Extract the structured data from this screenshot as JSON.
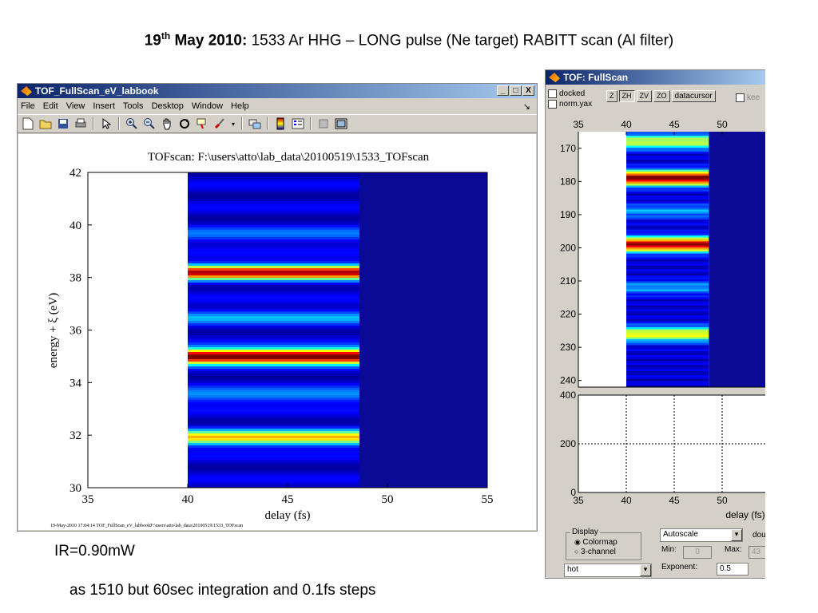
{
  "slide": {
    "title_bold": "19",
    "title_sup": "th",
    "title_bold2": " May 2010:",
    "title_rest": " 1533  Ar HHG – LONG pulse (Ne target) RABITT scan (Al filter)",
    "ir_note": "IR=0.90mW",
    "integration_note": "as 1510 but 60sec integration and 0.1fs steps"
  },
  "left_window": {
    "title": "TOF_FullScan_eV_labbook",
    "window_buttons": [
      "_",
      "□",
      "X"
    ],
    "menu": [
      "File",
      "Edit",
      "View",
      "Insert",
      "Tools",
      "Desktop",
      "Window",
      "Help"
    ],
    "menu_arrow": "↘",
    "toolbar_icons": [
      "new-file-icon",
      "open-folder-icon",
      "save-icon",
      "print-icon",
      "pointer-icon",
      "zoom-in-icon",
      "zoom-out-icon",
      "pan-hand-icon",
      "rotate-icon",
      "data-cursor-icon",
      "brush-icon",
      "dropdown-arrow-icon",
      "link-icon",
      "colorbar-icon",
      "legend-icon",
      "hide-plot-tools-icon",
      "show-plot-tools-icon"
    ],
    "plot_title": "TOFscan: F:\\users\\atto\\lab_data\\20100519\\1533_TOFscan",
    "footer": "19-May-2010 17:04:14  TOF_FullScan_eV_labbookF:\\users\\atto\\lab_data\\20100519\\1533_TOFscan"
  },
  "right_window": {
    "title": "TOF: FullScan",
    "docked_label": "docked",
    "normyax_label": "norm.yax",
    "buttons": [
      "Z",
      "ZH",
      "ZV",
      "ZO",
      "datacursor"
    ],
    "keep_label": "kee",
    "display_group": "Display",
    "colormap_label": "Colormap",
    "three_channel_label": "3-channel",
    "colormap_select": "hot",
    "autoscale_select": "Autoscale",
    "dou_label": "dou",
    "min_label": "Min:",
    "min_value": "0",
    "max_label": "Max:",
    "max_value": "43",
    "exponent_label": "Exponent:",
    "exponent_value": "0.5"
  },
  "chart_data": [
    {
      "type": "heatmap",
      "title": "TOFscan: F:\\users\\atto\\lab_data\\20100519\\1533_TOFscan",
      "xlabel": "delay (fs)",
      "ylabel": "energy + ξ (eV)",
      "xlim": [
        35,
        55
      ],
      "ylim": [
        30,
        42
      ],
      "x_ticks": [
        "35",
        "40",
        "45",
        "50",
        "55"
      ],
      "y_ticks": [
        "30",
        "32",
        "34",
        "36",
        "38",
        "40",
        "42"
      ],
      "data_x_range": [
        40,
        48.6
      ],
      "bands": [
        {
          "center": 31.9,
          "intensity": 0.6
        },
        {
          "center": 35.0,
          "intensity": 1.0
        },
        {
          "center": 38.2,
          "intensity": 0.85
        },
        {
          "center": 33.5,
          "intensity": 0.2
        },
        {
          "center": 36.5,
          "intensity": 0.2
        },
        {
          "center": 39.6,
          "intensity": 0.15
        }
      ]
    },
    {
      "type": "heatmap",
      "xlim": [
        35,
        55
      ],
      "ylim": [
        165,
        242
      ],
      "x_ticks": [
        "35",
        "40",
        "45",
        "50"
      ],
      "y_ticks": [
        "170",
        "180",
        "190",
        "200",
        "210",
        "220",
        "230",
        "240"
      ],
      "data_x_range": [
        40,
        48.6
      ],
      "bands": [
        {
          "center": 179,
          "intensity": 0.95
        },
        {
          "center": 199,
          "intensity": 0.9
        },
        {
          "center": 226,
          "intensity": 0.55
        },
        {
          "center": 168,
          "intensity": 0.5
        },
        {
          "center": 189,
          "intensity": 0.2
        },
        {
          "center": 212,
          "intensity": 0.2
        }
      ]
    },
    {
      "type": "line",
      "xlabel": "delay (fs)",
      "xlim": [
        35,
        55
      ],
      "ylim": [
        0,
        400
      ],
      "x_ticks": [
        "35",
        "40",
        "45",
        "50"
      ],
      "y_ticks": [
        "0",
        "200",
        "400"
      ],
      "grid": true,
      "series": []
    }
  ]
}
